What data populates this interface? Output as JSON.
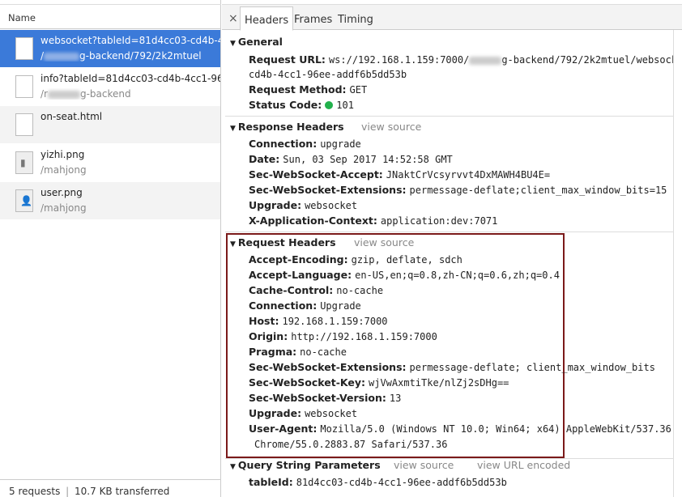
{
  "requests": {
    "column_header": "Name",
    "items": [
      {
        "line1": "websocket?tableId=81d4cc03-cd4b-4...",
        "line2_prefix": "/",
        "line2_suffix": "g-backend/792/2k2mtuel",
        "icon": "file-icon"
      },
      {
        "line1": "info?tableId=81d4cc03-cd4b-4cc1-96...",
        "line2_prefix": "/r",
        "line2_suffix": "g-backend",
        "icon": "file-icon"
      },
      {
        "line1": "on-seat.html",
        "line2_prefix": "",
        "line2_suffix": "",
        "icon": "file-icon"
      },
      {
        "line1": "yizhi.png",
        "line2_prefix": "/mahjong",
        "line2_suffix": "",
        "icon": "image-icon"
      },
      {
        "line1": "user.png",
        "line2_prefix": "/mahjong",
        "line2_suffix": "",
        "icon": "user-image-icon"
      }
    ],
    "footer": {
      "count": "5 requests",
      "separator": "|",
      "transferred": "10.7 KB transferred"
    }
  },
  "tabs": {
    "close": "×",
    "items": [
      "Headers",
      "Frames",
      "Timing"
    ],
    "active": "Headers"
  },
  "general": {
    "title": "General",
    "request_url_label": "Request URL:",
    "request_url_prefix": "ws://192.168.1.159:7000/",
    "request_url_mid": "g-backend/792/2k2mtuel/websock",
    "request_url_cont": "cd4b-4cc1-96ee-addf6b5dd53b",
    "request_method_label": "Request Method:",
    "request_method": "GET",
    "status_code_label": "Status Code:",
    "status_code": "101",
    "status_color": "#22b14c"
  },
  "response_headers": {
    "title": "Response Headers",
    "view_source": "view source",
    "items": [
      {
        "k": "Connection:",
        "v": "upgrade"
      },
      {
        "k": "Date:",
        "v": "Sun, 03 Sep 2017 14:52:58 GMT"
      },
      {
        "k": "Sec-WebSocket-Accept:",
        "v": "JNaktCrVcsyrvvt4DxMAWH4BU4E="
      },
      {
        "k": "Sec-WebSocket-Extensions:",
        "v": "permessage-deflate;client_max_window_bits=15"
      },
      {
        "k": "Upgrade:",
        "v": "websocket"
      },
      {
        "k": "X-Application-Context:",
        "v": "application:dev:7071"
      }
    ]
  },
  "request_headers": {
    "title": "Request Headers",
    "view_source": "view source",
    "items": [
      {
        "k": "Accept-Encoding:",
        "v": "gzip, deflate, sdch"
      },
      {
        "k": "Accept-Language:",
        "v": "en-US,en;q=0.8,zh-CN;q=0.6,zh;q=0.4"
      },
      {
        "k": "Cache-Control:",
        "v": "no-cache"
      },
      {
        "k": "Connection:",
        "v": "Upgrade"
      },
      {
        "k": "Host:",
        "v": "192.168.1.159:7000"
      },
      {
        "k": "Origin:",
        "v": "http://192.168.1.159:7000"
      },
      {
        "k": "Pragma:",
        "v": "no-cache"
      },
      {
        "k": "Sec-WebSocket-Extensions:",
        "v": "permessage-deflate; client_max_window_bits"
      },
      {
        "k": "Sec-WebSocket-Key:",
        "v": "wjVwAxmtiTke/nlZj2sDHg=="
      },
      {
        "k": "Sec-WebSocket-Version:",
        "v": "13"
      },
      {
        "k": "Upgrade:",
        "v": "websocket"
      },
      {
        "k": "User-Agent:",
        "v": "Mozilla/5.0 (Windows NT 10.0; Win64; x64) AppleWebKit/537.36"
      }
    ],
    "user_agent_cont": "Chrome/55.0.2883.87 Safari/537.36",
    "highlight_color": "#7b1a1a"
  },
  "query_params": {
    "title": "Query String Parameters",
    "view_source": "view source",
    "view_url_encoded": "view URL encoded",
    "items": [
      {
        "k": "tableId:",
        "v": "81d4cc03-cd4b-4cc1-96ee-addf6b5dd53b"
      }
    ]
  }
}
